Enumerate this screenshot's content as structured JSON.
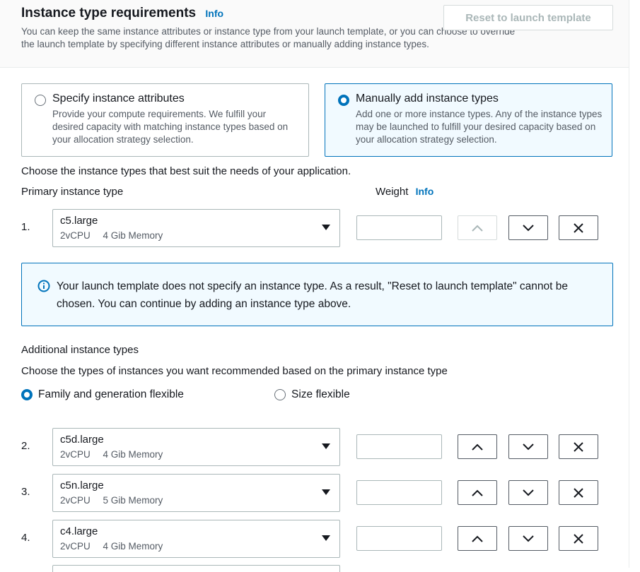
{
  "header": {
    "title": "Instance type requirements",
    "info": "Info",
    "description": "You can keep the same instance attributes or instance type from your launch template, or you can choose to override the launch template by specifying different instance attributes or manually adding instance types.",
    "reset_label": "Reset to launch template"
  },
  "tiles": [
    {
      "title": "Specify instance attributes",
      "description": "Provide your compute requirements. We fulfill your desired capacity with matching instance types based on your allocation strategy selection.",
      "selected": false
    },
    {
      "title": "Manually add instance types",
      "description": "Add one or more instance types. Any of the instance types may be launched to fulfill your desired capacity based on your allocation strategy selection.",
      "selected": true
    }
  ],
  "choose_text": "Choose the instance types that best suit the needs of your application.",
  "primary": {
    "label": "Primary instance type",
    "weight_label": "Weight",
    "weight_info": "Info",
    "row": {
      "num": "1.",
      "name": "c5.large",
      "vcpu": "2vCPU",
      "memory": "4 Gib Memory",
      "weight": ""
    }
  },
  "alert": {
    "icon": "info-circle-icon",
    "text": "Your launch template does not specify an instance type. As a result, \"Reset to launch template\" cannot be chosen. You can continue by adding an instance type above."
  },
  "additional": {
    "label": "Additional instance types",
    "prompt": "Choose the types of instances you want recommended based on the primary instance type",
    "options": [
      {
        "label": "Family and generation flexible",
        "selected": true
      },
      {
        "label": "Size flexible",
        "selected": false
      }
    ],
    "rows": [
      {
        "num": "2.",
        "name": "c5d.large",
        "vcpu": "2vCPU",
        "memory": "4 Gib Memory",
        "weight": ""
      },
      {
        "num": "3.",
        "name": "c5n.large",
        "vcpu": "2vCPU",
        "memory": "5 Gib Memory",
        "weight": ""
      },
      {
        "num": "4.",
        "name": "c4.large",
        "vcpu": "2vCPU",
        "memory": "4 Gib Memory",
        "weight": ""
      }
    ]
  },
  "colors": {
    "accent": "#0073bb",
    "selected_bg": "#f1faff",
    "border": "#aab7b8",
    "disabled": "#aab7b8"
  }
}
